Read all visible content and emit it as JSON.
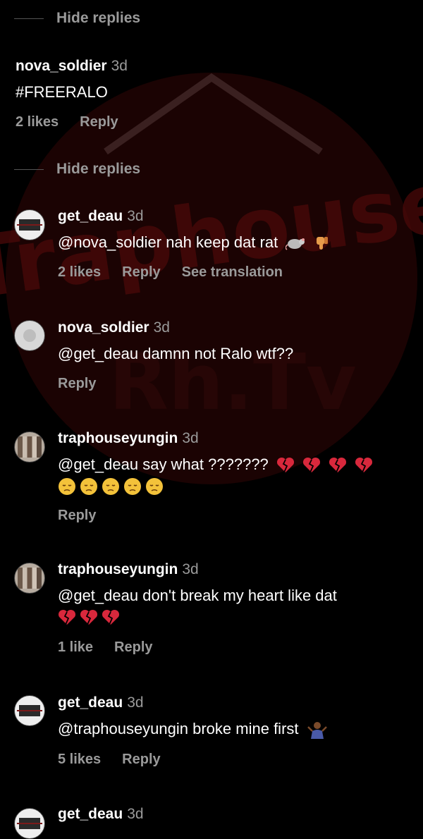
{
  "watermark": {
    "line1": "Traphouse",
    "line2": "Rh.Tv"
  },
  "hide_replies_1": {
    "label": "Hide replies"
  },
  "comment_1": {
    "username": "nova_soldier",
    "time": "3d",
    "text": "#FREERALO",
    "likes": "2 likes",
    "reply": "Reply"
  },
  "hide_replies_2": {
    "label": "Hide replies"
  },
  "comment_2": {
    "username": "get_deau",
    "time": "3d",
    "text": "@nova_soldier nah keep dat rat",
    "emojis": [
      "rat-icon",
      "thumbs-down-icon"
    ],
    "likes": "2 likes",
    "reply": "Reply",
    "translate": "See translation"
  },
  "comment_3": {
    "username": "nova_soldier",
    "time": "3d",
    "text": "@get_deau damnn not Ralo wtf??",
    "reply": "Reply"
  },
  "comment_4": {
    "username": "traphouseyungin",
    "time": "3d",
    "text": "@get_deau say what ???????",
    "reply": "Reply"
  },
  "comment_5": {
    "username": "traphouseyungin",
    "time": "3d",
    "text": "@get_deau don't break my heart like dat",
    "likes": "1 like",
    "reply": "Reply"
  },
  "comment_6": {
    "username": "get_deau",
    "time": "3d",
    "text": "@traphouseyungin broke mine first",
    "likes": "5 likes",
    "reply": "Reply"
  },
  "comment_7": {
    "username": "get_deau",
    "time": "3d"
  },
  "colors": {
    "background": "#000000",
    "muted": "#9a9a9a",
    "heart": "#d8283c",
    "face": "#f3c23a",
    "watermark": "#5a0b0b"
  }
}
